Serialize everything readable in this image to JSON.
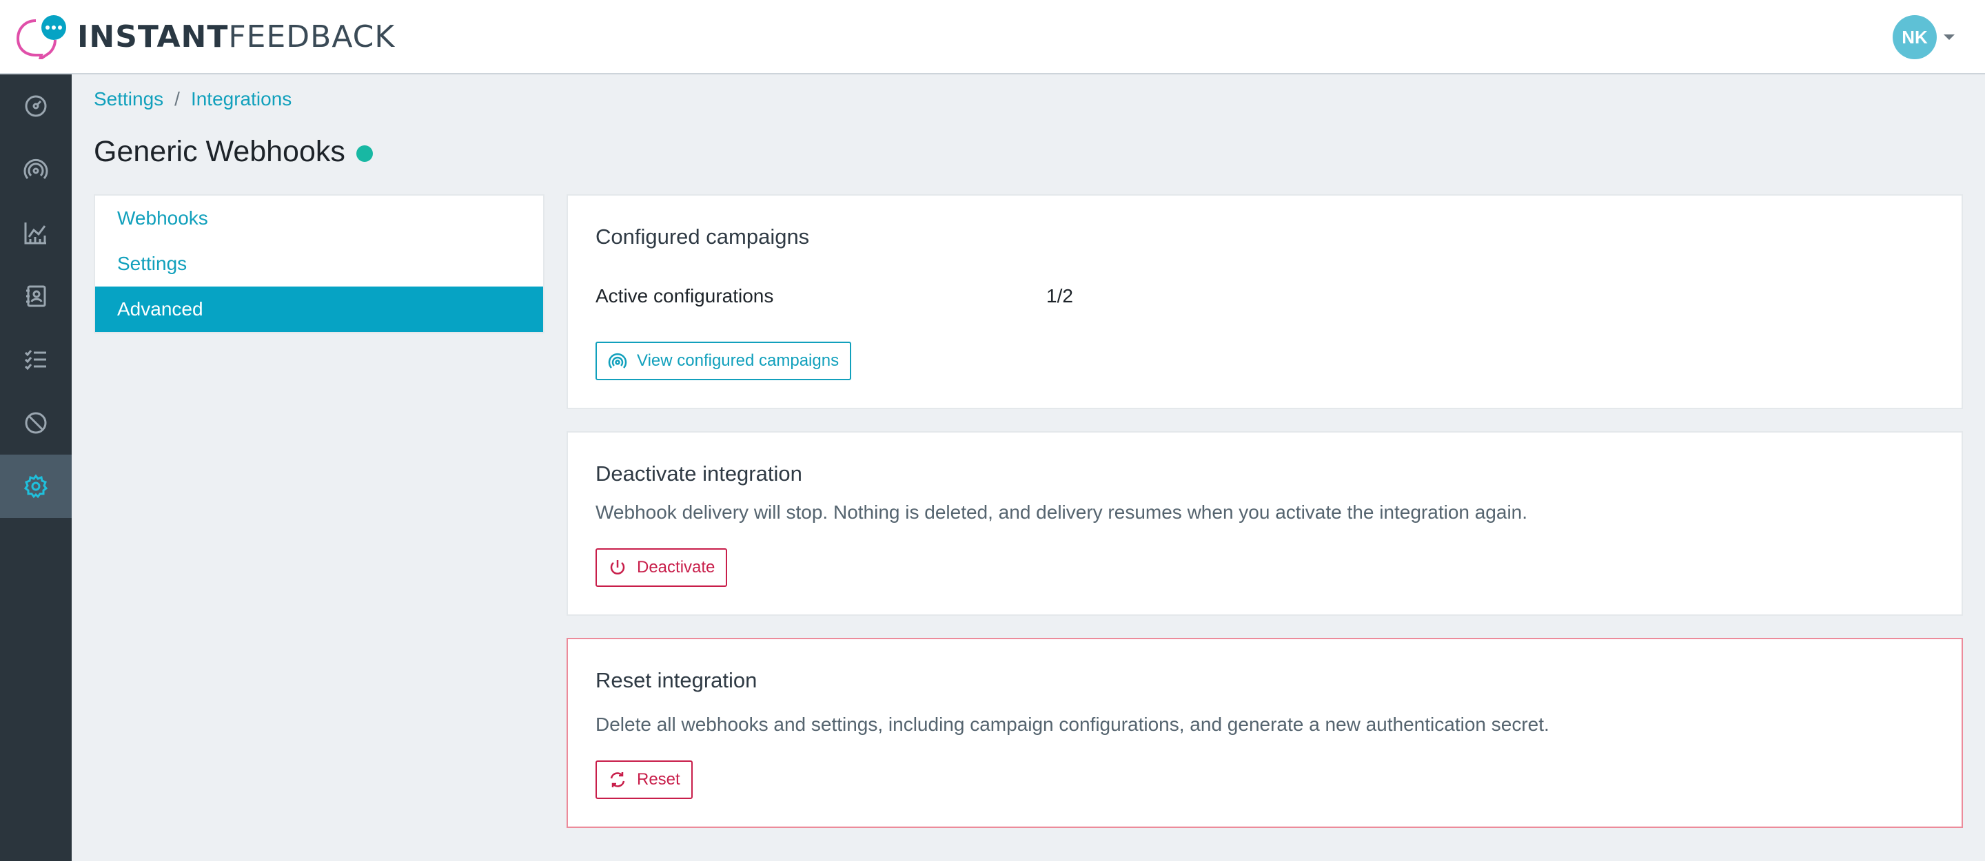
{
  "app": {
    "logo_bold": "INSTANT",
    "logo_light": "FEEDBACK",
    "brand_colors": {
      "teal": "#06a3c4",
      "pink": "#e04fa9",
      "danger": "#c81e4a",
      "status_green": "#18b8a3"
    }
  },
  "header": {
    "user_initials": "NK"
  },
  "sidebar": {
    "items": [
      {
        "icon": "dashboard-gauge-icon"
      },
      {
        "icon": "broadcast-icon"
      },
      {
        "icon": "chart-icon"
      },
      {
        "icon": "contacts-book-icon"
      },
      {
        "icon": "checklist-icon"
      },
      {
        "icon": "block-icon"
      },
      {
        "icon": "gear-icon",
        "active": true
      }
    ]
  },
  "breadcrumb": {
    "items": [
      "Settings",
      "Integrations"
    ],
    "separator": "/"
  },
  "page": {
    "title": "Generic Webhooks"
  },
  "subnav": {
    "items": [
      "Webhooks",
      "Settings",
      "Advanced"
    ],
    "active": "Advanced"
  },
  "cards": {
    "campaigns": {
      "title": "Configured campaigns",
      "row_label": "Active configurations",
      "row_value": "1/2",
      "button": "View configured campaigns"
    },
    "deactivate": {
      "title": "Deactivate integration",
      "description": "Webhook delivery will stop. Nothing is deleted, and delivery resumes when you activate the integration again.",
      "button": "Deactivate"
    },
    "reset": {
      "title": "Reset integration",
      "description": "Delete all webhooks and settings, including campaign configurations, and generate a new authentication secret.",
      "button": "Reset"
    }
  }
}
